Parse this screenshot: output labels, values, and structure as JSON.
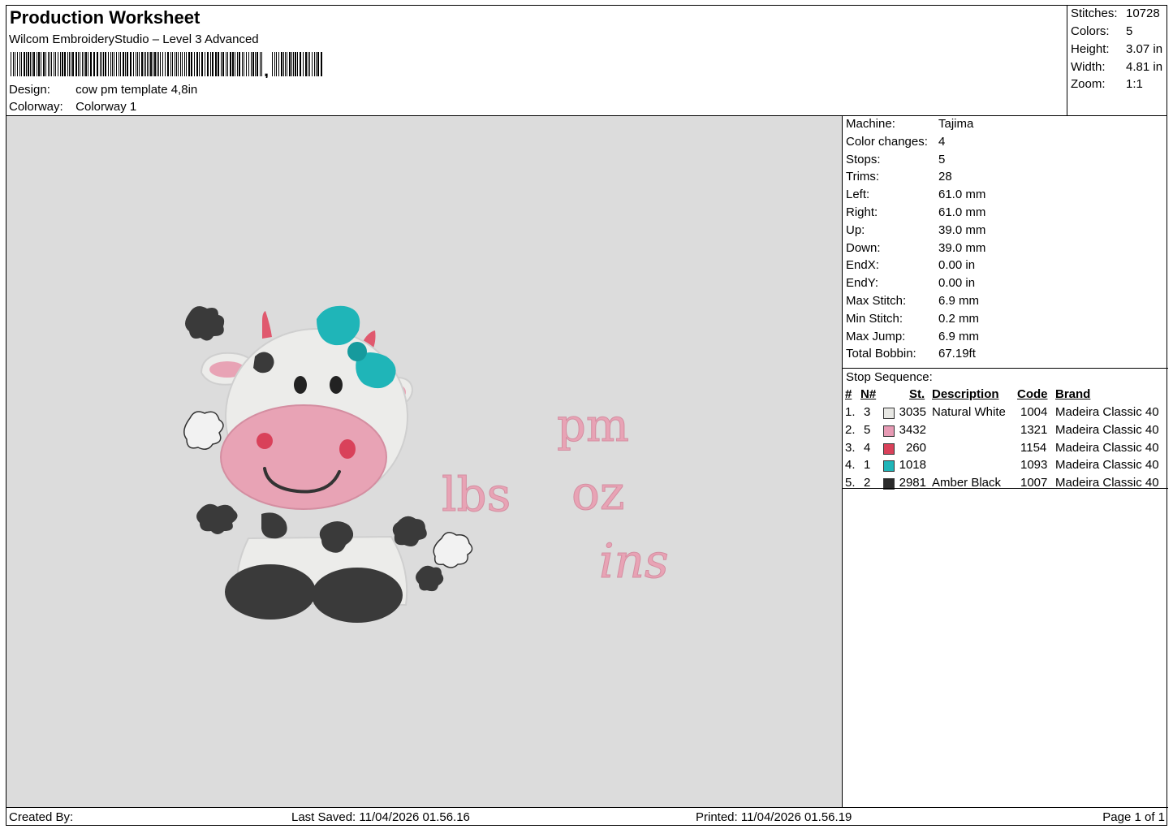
{
  "header": {
    "title": "Production Worksheet",
    "software": "Wilcom EmbroideryStudio – Level 3 Advanced",
    "design_label": "Design:",
    "design_value": "cow pm template 4,8in",
    "colorway_label": "Colorway:",
    "colorway_value": "Colorway 1"
  },
  "summary": [
    {
      "label": "Stitches:",
      "value": "10728"
    },
    {
      "label": "Colors:",
      "value": "5"
    },
    {
      "label": "Height:",
      "value": "3.07 in"
    },
    {
      "label": "Width:",
      "value": "4.81 in"
    },
    {
      "label": "Zoom:",
      "value": "1:1"
    }
  ],
  "design_text": {
    "lbs": "lbs",
    "pm": "pm",
    "oz": "oz",
    "ins": "ins"
  },
  "properties": [
    {
      "label": "Machine:",
      "value": "Tajima"
    },
    {
      "label": "Color changes:",
      "value": "4"
    },
    {
      "label": "Stops:",
      "value": "5"
    },
    {
      "label": "Trims:",
      "value": "28"
    },
    {
      "label": "Left:",
      "value": "61.0 mm"
    },
    {
      "label": "Right:",
      "value": "61.0 mm"
    },
    {
      "label": "Up:",
      "value": "39.0 mm"
    },
    {
      "label": "Down:",
      "value": "39.0 mm"
    },
    {
      "label": "EndX:",
      "value": "0.00 in"
    },
    {
      "label": "EndY:",
      "value": "0.00 in"
    },
    {
      "label": "Max Stitch:",
      "value": "6.9 mm"
    },
    {
      "label": "Min Stitch:",
      "value": "0.2 mm"
    },
    {
      "label": "Max Jump:",
      "value": "6.9 mm"
    },
    {
      "label": "Total Bobbin:",
      "value": "67.19ft"
    }
  ],
  "stop_sequence": {
    "title": "Stop Sequence:",
    "headers": {
      "num": "#",
      "n": "N#",
      "st": "St.",
      "description": "Description",
      "code": "Code",
      "brand": "Brand"
    },
    "rows": [
      {
        "num": "1.",
        "n": "3",
        "color": "#e8e8e4",
        "st": "3035",
        "description": "Natural White",
        "code": "1004",
        "brand": "Madeira Classic 40"
      },
      {
        "num": "2.",
        "n": "5",
        "color": "#e79ab4",
        "st": "3432",
        "description": "",
        "code": "1321",
        "brand": "Madeira Classic 40"
      },
      {
        "num": "3.",
        "n": "4",
        "color": "#d9415a",
        "st": "260",
        "description": "",
        "code": "1154",
        "brand": "Madeira Classic 40"
      },
      {
        "num": "4.",
        "n": "1",
        "color": "#1fb5b8",
        "st": "1018",
        "description": "",
        "code": "1093",
        "brand": "Madeira Classic 40"
      },
      {
        "num": "5.",
        "n": "2",
        "color": "#2b2b2b",
        "st": "2981",
        "description": "Amber Black",
        "code": "1007",
        "brand": "Madeira Classic 40"
      }
    ]
  },
  "footer": {
    "created_by": "Created By:",
    "last_saved": "Last Saved: 11/04/2026 01.56.16",
    "printed": "Printed: 11/04/2026 01.56.19",
    "page": "Page 1 of 1"
  }
}
